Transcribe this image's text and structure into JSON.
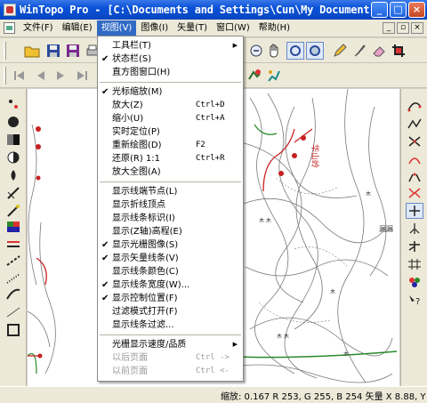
{
  "window": {
    "title": "WinTopo Pro - [C:\\Documents and Settings\\Cun\\My Document...",
    "min_icon": "minimize-icon",
    "max_icon": "maximize-icon",
    "close_icon": "close-icon"
  },
  "menubar": {
    "items": [
      "文件(F)",
      "编辑(E)",
      "视图(V)",
      "图像(I)",
      "矢量(T)",
      "窗口(W)",
      "帮助(H)"
    ],
    "active": "视图(V)"
  },
  "view_menu": {
    "items": [
      {
        "label": "工具栏(T)",
        "checked": false,
        "shortcut": "",
        "submenu": true,
        "enabled": true
      },
      {
        "label": "状态栏(S)",
        "checked": true,
        "shortcut": "",
        "submenu": false,
        "enabled": true
      },
      {
        "label": "直方图窗口(H)",
        "checked": false,
        "shortcut": "",
        "submenu": false,
        "enabled": true
      },
      {
        "label": "光标缩放(M)",
        "checked": true,
        "shortcut": "",
        "submenu": false,
        "enabled": true
      },
      {
        "label": "放大(Z)",
        "checked": false,
        "shortcut": "Ctrl+D",
        "submenu": false,
        "enabled": true
      },
      {
        "label": "缩小(U)",
        "checked": false,
        "shortcut": "Ctrl+A",
        "submenu": false,
        "enabled": true
      },
      {
        "label": "实时定位(P)",
        "checked": false,
        "shortcut": "",
        "submenu": false,
        "enabled": true
      },
      {
        "label": "重新绘图(D)",
        "checked": false,
        "shortcut": "F2",
        "submenu": false,
        "enabled": true
      },
      {
        "label": "还原(R) 1:1",
        "checked": false,
        "shortcut": "Ctrl+R",
        "submenu": false,
        "enabled": true
      },
      {
        "label": "放大全图(A)",
        "checked": false,
        "shortcut": "",
        "submenu": false,
        "enabled": true
      },
      {
        "label": "显示线端节点(L)",
        "checked": false,
        "shortcut": "",
        "submenu": false,
        "enabled": true
      },
      {
        "label": "显示折线顶点",
        "checked": false,
        "shortcut": "",
        "submenu": false,
        "enabled": true
      },
      {
        "label": "显示线条标识(I)",
        "checked": false,
        "shortcut": "",
        "submenu": false,
        "enabled": true
      },
      {
        "label": "显示(Z轴)高程(E)",
        "checked": false,
        "shortcut": "",
        "submenu": false,
        "enabled": true
      },
      {
        "label": "显示光栅图像(S)",
        "checked": true,
        "shortcut": "",
        "submenu": false,
        "enabled": true
      },
      {
        "label": "显示矢量线条(V)",
        "checked": true,
        "shortcut": "",
        "submenu": false,
        "enabled": true
      },
      {
        "label": "显示线条颜色(C)",
        "checked": false,
        "shortcut": "",
        "submenu": false,
        "enabled": true
      },
      {
        "label": "显示线条宽度(W)...",
        "checked": true,
        "shortcut": "",
        "submenu": false,
        "enabled": true
      },
      {
        "label": "显示控制位置(F)",
        "checked": true,
        "shortcut": "",
        "submenu": false,
        "enabled": true
      },
      {
        "label": "过滤模式打开(F)",
        "checked": false,
        "shortcut": "",
        "submenu": false,
        "enabled": true
      },
      {
        "label": "显示线条过滤...",
        "checked": false,
        "shortcut": "",
        "submenu": false,
        "enabled": true
      },
      {
        "label": "光栅显示速度/品质",
        "checked": false,
        "shortcut": "",
        "submenu": true,
        "enabled": true
      },
      {
        "label": "以后页面",
        "checked": false,
        "shortcut": "Ctrl ->",
        "submenu": false,
        "enabled": false
      },
      {
        "label": "以前页面",
        "checked": false,
        "shortcut": "Ctrl <-",
        "submenu": false,
        "enabled": false
      }
    ],
    "separators_after": [
      2,
      9,
      20
    ]
  },
  "statusbar": {
    "text": "缩放: 0.167 R 253, G 255, B 254  矢量 X 8.88, Y"
  },
  "map": {
    "labels": [
      "华山岭",
      "漏漏"
    ]
  },
  "colors": {
    "title_blue": "#0a52d8",
    "menu_highlight": "#316ac5",
    "map_contour": "#7a7a7a",
    "map_red": "#c82020",
    "map_green": "#2a8a2a"
  }
}
